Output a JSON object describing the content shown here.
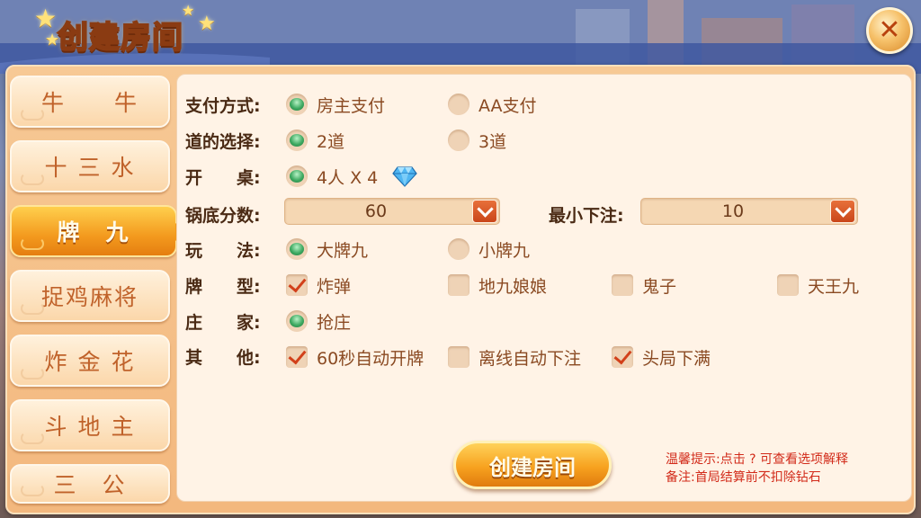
{
  "colors": {
    "accent": "#f39a1e",
    "panel": "#fff3e6",
    "label": "#4a2a14",
    "option": "#8a4a22",
    "tip": "#d22b1a",
    "radio_on": "#3faa62",
    "check_mark": "#d2401a"
  },
  "header": {
    "title": "创建房间",
    "close_icon": "close-x"
  },
  "tabs": [
    {
      "label": "牛　　牛",
      "active": false
    },
    {
      "label": "十 三 水",
      "active": false
    },
    {
      "label": "牌　九",
      "active": true
    },
    {
      "label": "捉鸡麻将",
      "active": false
    },
    {
      "label": "炸 金 花",
      "active": false
    },
    {
      "label": "斗 地 主",
      "active": false
    },
    {
      "label": "三　公",
      "active": false
    }
  ],
  "form": {
    "payment": {
      "label": "支付方式:",
      "options": [
        {
          "text": "房主支付",
          "selected": true
        },
        {
          "text": "AA支付",
          "selected": false
        }
      ]
    },
    "lanes": {
      "label": "道的选择:",
      "options": [
        {
          "text": "2道",
          "selected": true
        },
        {
          "text": "3道",
          "selected": false
        }
      ]
    },
    "table": {
      "label": "开　　桌:",
      "options": [
        {
          "text": "4人 X 4",
          "selected": true
        }
      ],
      "cost_icon": "diamond-icon"
    },
    "base_score": {
      "label": "锅底分数:",
      "value": "60"
    },
    "min_bet": {
      "label": "最小下注:",
      "value": "10"
    },
    "play": {
      "label": "玩　　法:",
      "options": [
        {
          "text": "大牌九",
          "selected": true
        },
        {
          "text": "小牌九",
          "selected": false
        }
      ]
    },
    "card_types": {
      "label": "牌　　型:",
      "options": [
        {
          "text": "炸弹",
          "checked": true
        },
        {
          "text": "地九娘娘",
          "checked": false
        },
        {
          "text": "鬼子",
          "checked": false
        },
        {
          "text": "天王九",
          "checked": false
        }
      ]
    },
    "banker": {
      "label": "庄　　家:",
      "options": [
        {
          "text": "抢庄",
          "selected": true
        }
      ]
    },
    "other": {
      "label": "其　　他:",
      "options": [
        {
          "text": "60秒自动开牌",
          "checked": true
        },
        {
          "text": "离线自动下注",
          "checked": false
        },
        {
          "text": "头局下满",
          "checked": true
        }
      ]
    }
  },
  "footer": {
    "create_label": "创建房间",
    "tip_line1": "温馨提示:点击 ? 可查看选项解释",
    "tip_line2": "备注:首局结算前不扣除钻石"
  }
}
